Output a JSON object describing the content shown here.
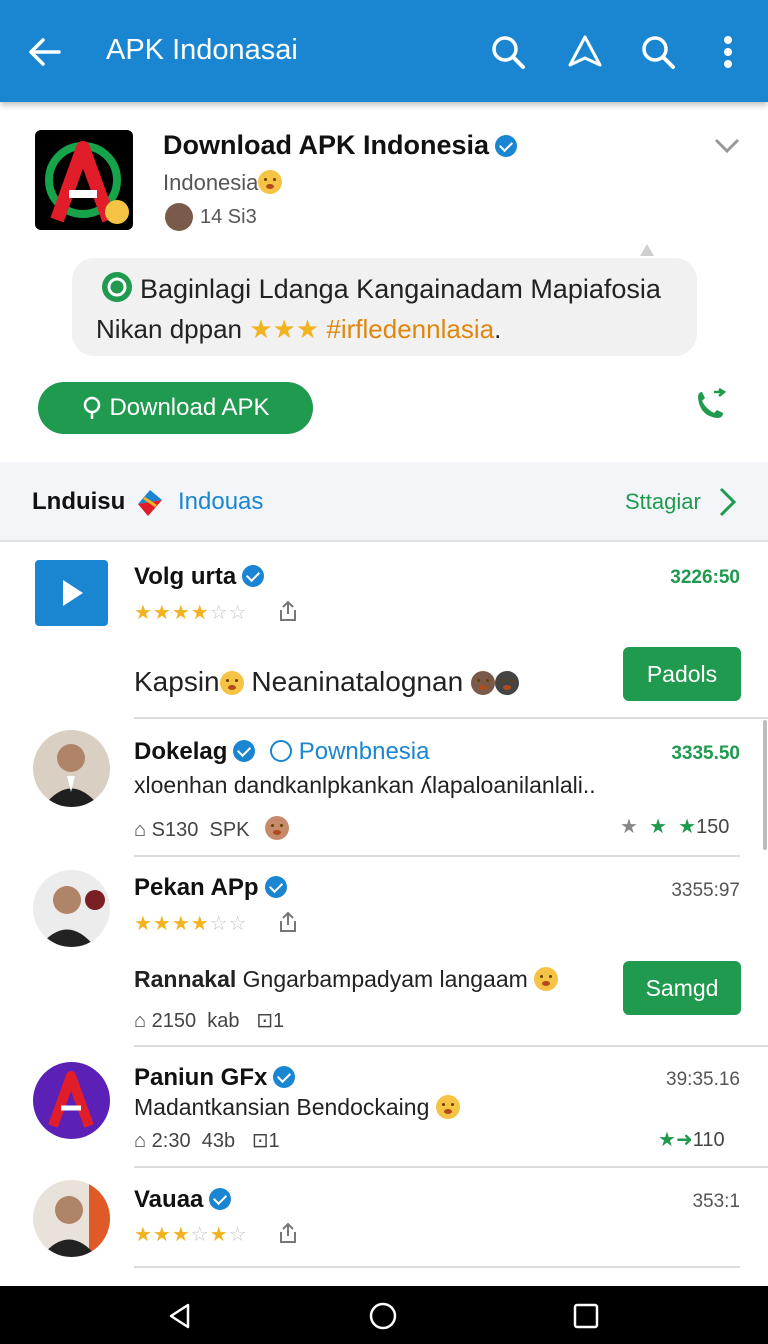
{
  "appbar": {
    "title": "APK Indonasai",
    "color": "#1a86d2",
    "icons": [
      "back-arrow-icon",
      "search-icon",
      "share-icon",
      "search-icon",
      "more-vert-icon"
    ]
  },
  "header": {
    "title": "Download APK Indonesia",
    "subtitle": "Indonesia",
    "count": "14 Si3",
    "bubble_line1": "Baginlagi Ldanga Kangainadam Mapiafosia",
    "bubble_line2_text": "Nikan dppan",
    "bubble_tag": "#irfledennlasia",
    "bubble_end": ".",
    "download_label": "Download APK"
  },
  "section": {
    "left": "Lnduisu",
    "middle": "Indouas",
    "right": "Sttagiar"
  },
  "items": [
    {
      "name": "Volg urta",
      "price": "3226:50",
      "rating": 3.5,
      "desc": "Kapsin",
      "desc2": "Neaninatalognan",
      "button": "Padols"
    },
    {
      "name": "Dokelag",
      "tag": "Pownbnesia",
      "price": "3335.50",
      "desc": "xloenhan dandkanlpkankan ʎlapaloanilanlali..",
      "meta1": "S130",
      "meta2": "SPK",
      "stars_right": "150"
    },
    {
      "name": "Pekan APp",
      "price": "3355:97",
      "rating": 3.5,
      "desc_bold": "Rannakal",
      "desc": "Gngarbampadyam langaam",
      "meta1": "2150",
      "meta2": "kab",
      "meta3": "1",
      "button": "Samgd"
    },
    {
      "name": "Paniun GFx",
      "price": "39:35.16",
      "desc": "Madantkansian Bendockaing",
      "meta1": "2:30",
      "meta2": "43b",
      "meta3": "1",
      "stars_right": "110"
    },
    {
      "name": "Vauaa",
      "price": "353:1",
      "rating": 3.5
    }
  ],
  "colors": {
    "accent_green": "#1f9a4e",
    "accent_blue": "#1a86d2",
    "star": "#f2b321"
  }
}
